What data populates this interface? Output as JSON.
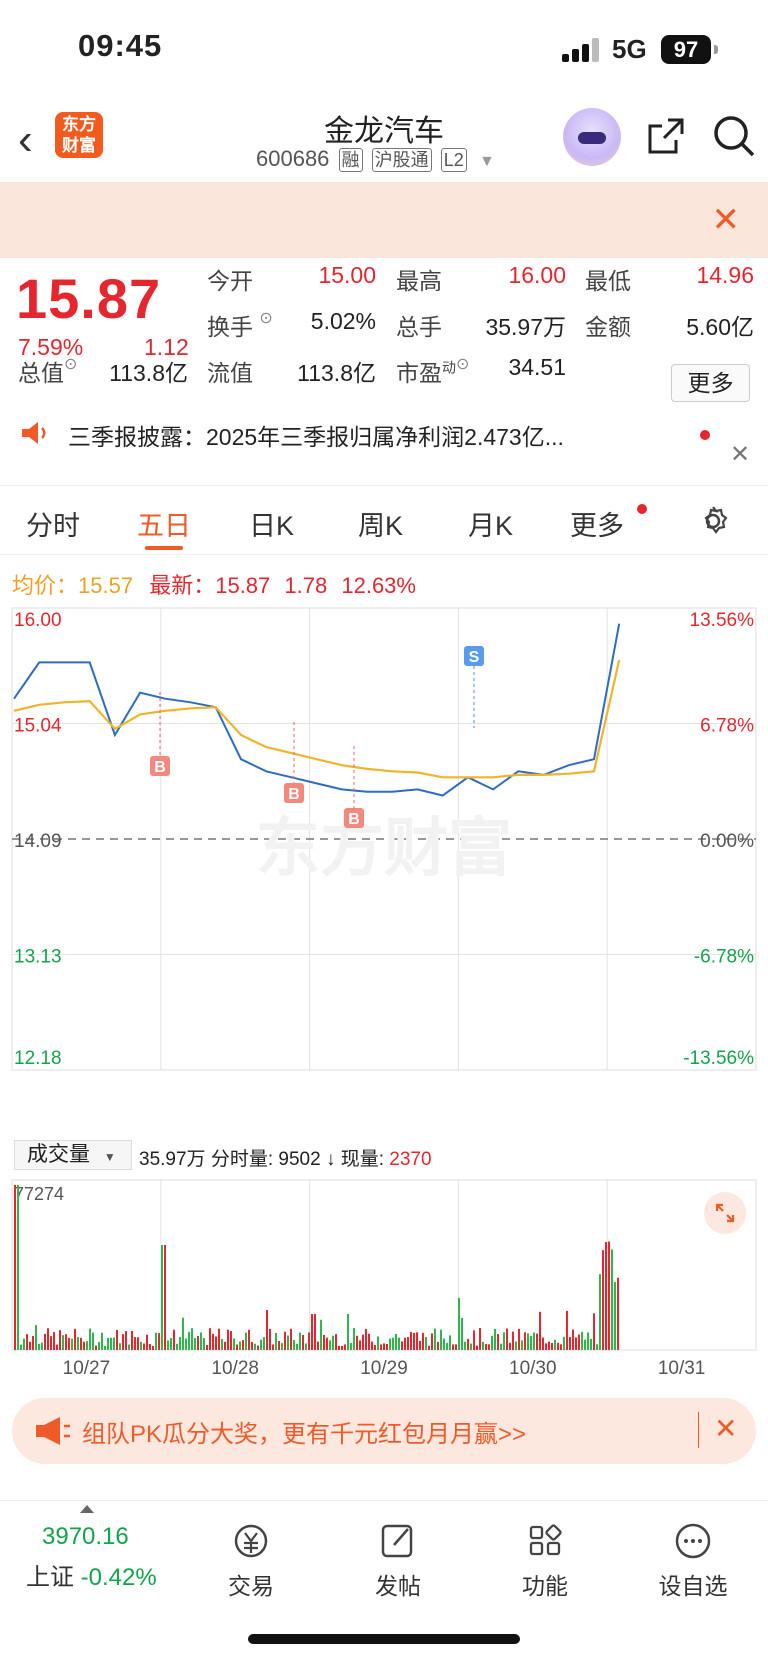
{
  "status": {
    "time": "09:45",
    "network": "5G",
    "battery": "97"
  },
  "header": {
    "title": "金龙汽车",
    "code": "600686",
    "tags": [
      "融",
      "沪股通",
      "L2"
    ],
    "logo": "东方财富"
  },
  "quote": {
    "price": "15.87",
    "change_pct": "7.59%",
    "change": "1.12",
    "open_label": "今开",
    "open": "15.00",
    "high_label": "最高",
    "high": "16.00",
    "low_label": "最低",
    "low": "14.96",
    "turnover_label": "换手",
    "turnover": "5.02%",
    "volume_label": "总手",
    "volume": "35.97万",
    "amount_label": "金额",
    "amount": "5.60亿",
    "mktcap_label": "总值",
    "mktcap": "113.8亿",
    "float_label": "流值",
    "float": "113.8亿",
    "pe_label": "市盈",
    "pe_sup": "动",
    "pe": "34.51",
    "more": "更多"
  },
  "news": {
    "text": "三季报披露：2025年三季报归属净利润2.473亿..."
  },
  "tabs": [
    "分时",
    "五日",
    "日K",
    "周K",
    "月K",
    "更多"
  ],
  "legend": {
    "avg_label": "均价：",
    "avg": "15.57",
    "last_label": "最新：",
    "last": "15.87",
    "chg": "1.78",
    "pct": "12.63%"
  },
  "chart_data": {
    "type": "line",
    "x": [
      "10/27",
      "10/28",
      "10/29",
      "10/30",
      "10/31"
    ],
    "y_left_ticks": [
      "16.00",
      "15.04",
      "14.09",
      "13.13",
      "12.18"
    ],
    "y_right_ticks": [
      "13.56%",
      "6.78%",
      "0.00%",
      "-6.78%",
      "-13.56%"
    ],
    "ylim": [
      12.18,
      16.0
    ],
    "reference": 14.09,
    "series": [
      {
        "name": "价格",
        "color": "#2c6cc4",
        "values": [
          15.25,
          15.55,
          15.55,
          15.55,
          14.95,
          15.3,
          15.25,
          15.22,
          15.18,
          14.75,
          14.65,
          14.6,
          14.55,
          14.5,
          14.48,
          14.48,
          14.5,
          14.45,
          14.6,
          14.5,
          14.65,
          14.62,
          14.7,
          14.75,
          15.87
        ]
      },
      {
        "name": "均价",
        "color": "#f0b429",
        "values": [
          15.15,
          15.2,
          15.22,
          15.23,
          15.0,
          15.12,
          15.15,
          15.17,
          15.18,
          14.95,
          14.85,
          14.8,
          14.75,
          14.7,
          14.67,
          14.65,
          14.64,
          14.6,
          14.6,
          14.6,
          14.62,
          14.62,
          14.63,
          14.65,
          15.57
        ]
      }
    ],
    "markers": [
      "B",
      "B",
      "B",
      "S"
    ],
    "watermark": "东方财富"
  },
  "volume": {
    "label": "成交量",
    "total": "35.97万",
    "tick_label": "分时量:",
    "tick_val": "9502",
    "now_label": "现量:",
    "now_val": "2370",
    "max": "77274"
  },
  "promo": {
    "text": "组队PK瓜分大奖，更有千元红包月月赢>>"
  },
  "bottom_nav": {
    "index_val": "3970.16",
    "index_name": "上证",
    "index_pct": "-0.42%",
    "items": [
      "交易",
      "发帖",
      "功能",
      "设自选"
    ]
  }
}
